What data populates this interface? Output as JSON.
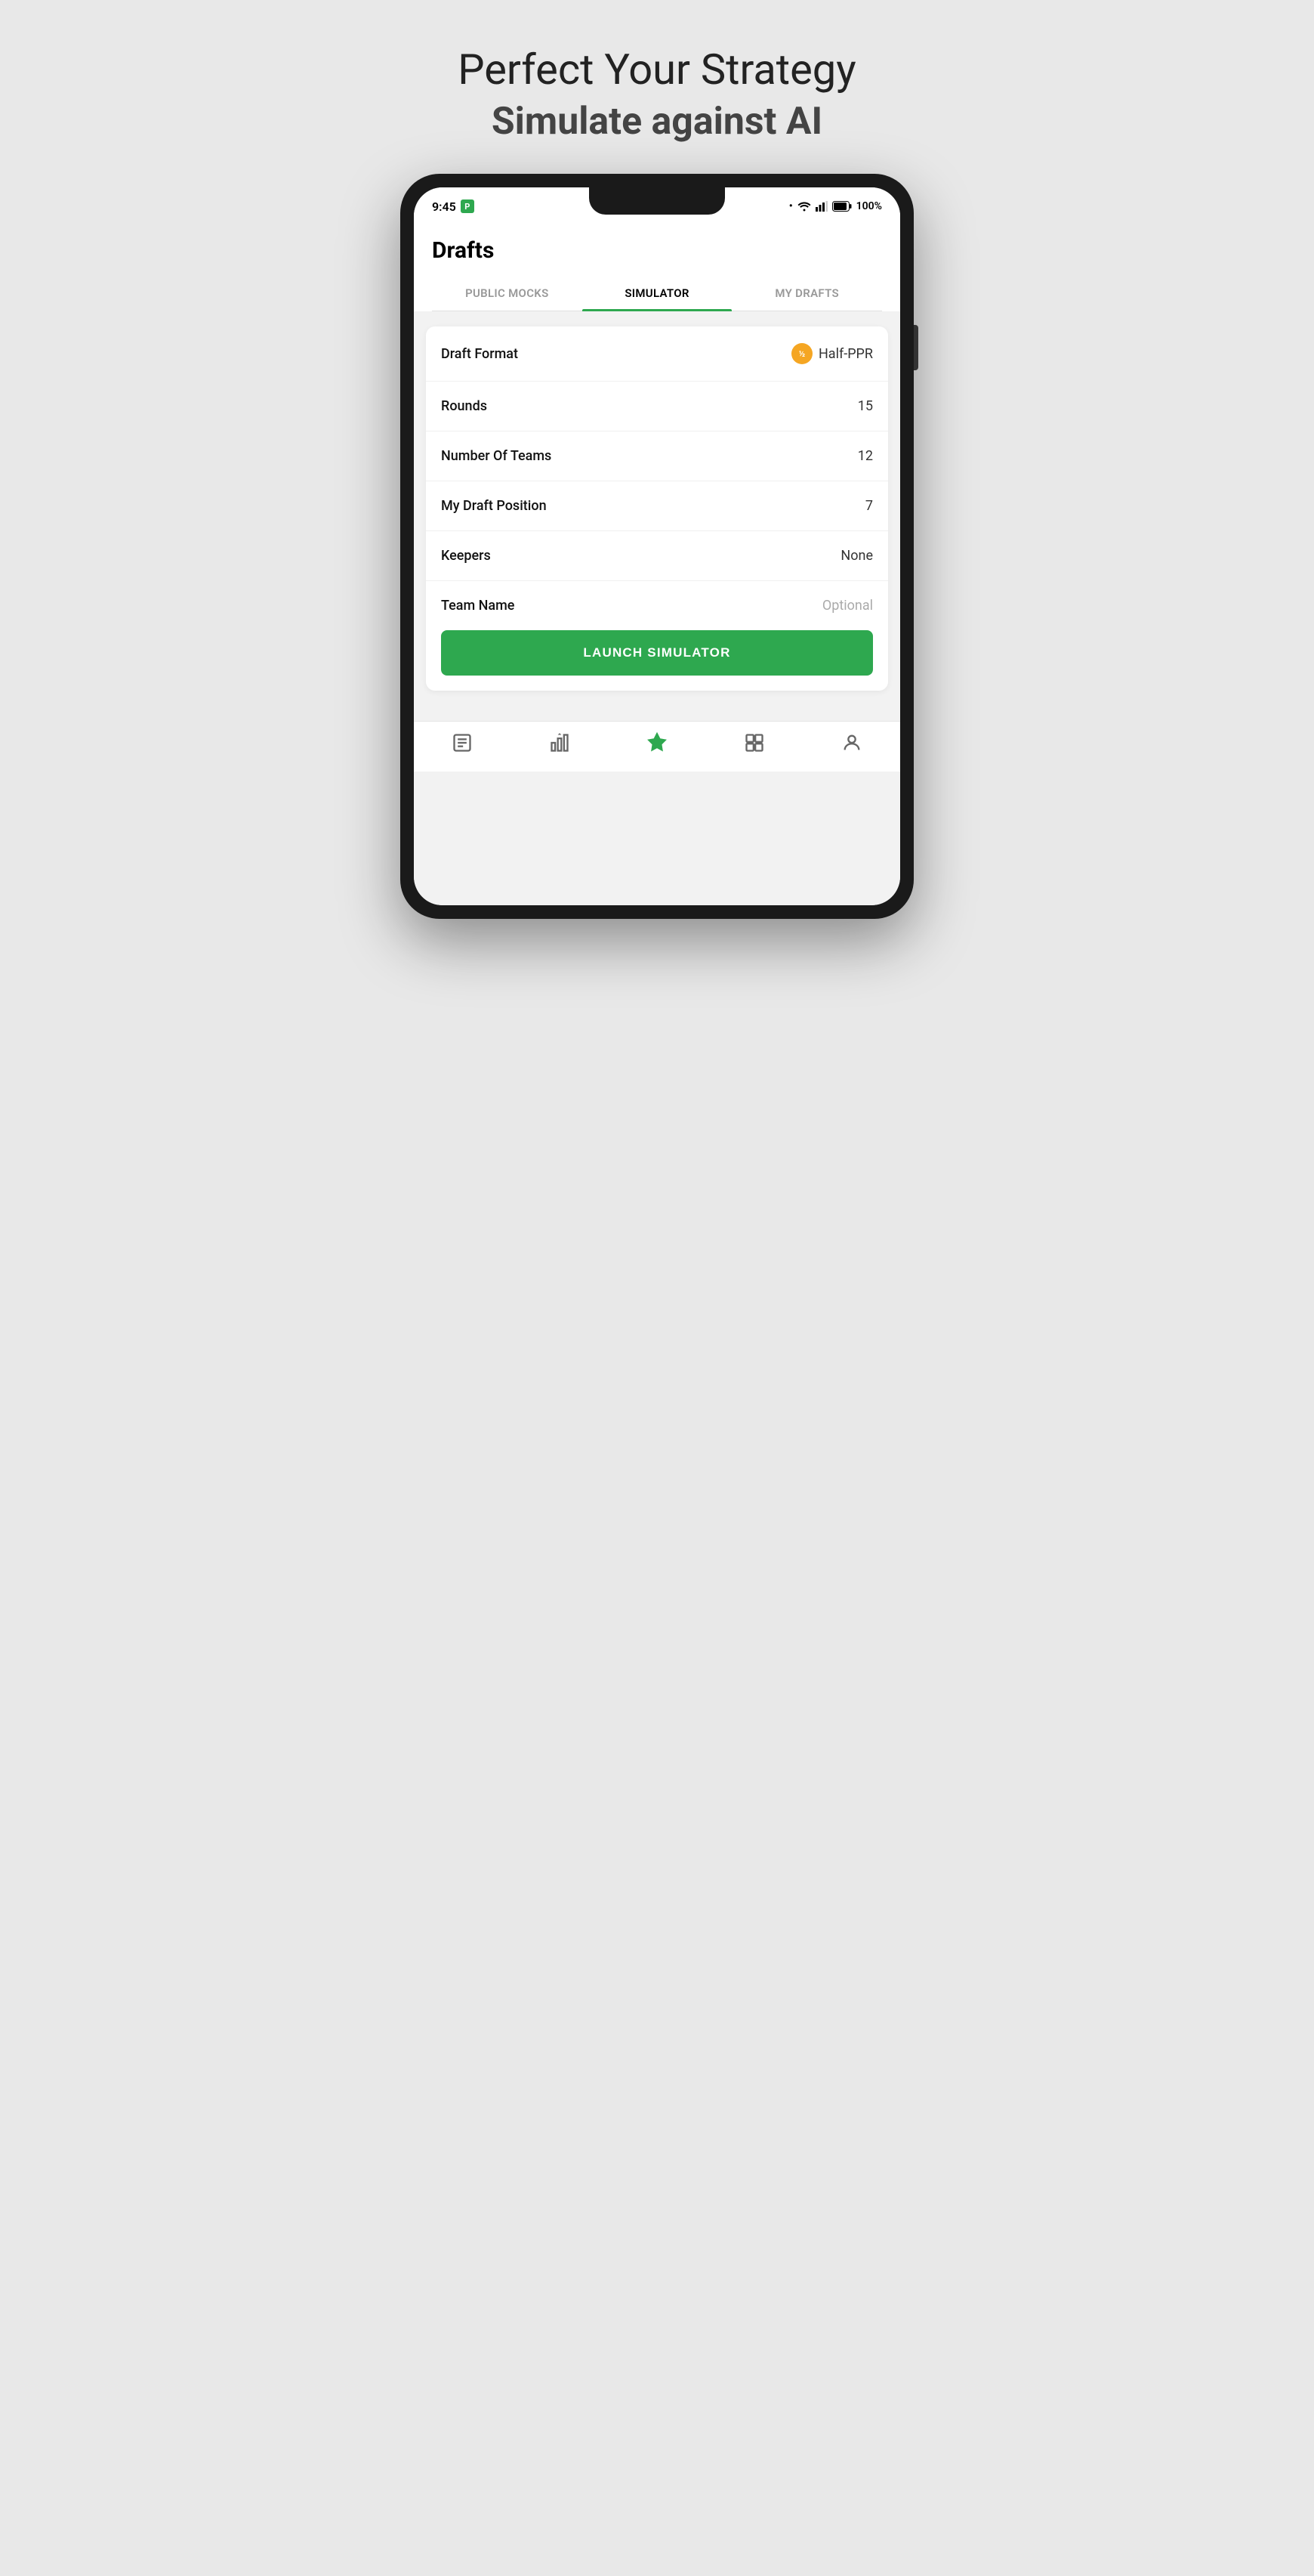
{
  "headline": "Perfect Your Strategy",
  "subheadline": "Simulate against AI",
  "status": {
    "time": "9:45",
    "battery": "100%"
  },
  "app": {
    "title": "Drafts",
    "tabs": [
      {
        "id": "public-mocks",
        "label": "PUBLIC MOCKS",
        "active": false
      },
      {
        "id": "simulator",
        "label": "SIMULATOR",
        "active": true
      },
      {
        "id": "my-drafts",
        "label": "MY DRAFTS",
        "active": false
      }
    ],
    "settings": [
      {
        "id": "draft-format",
        "label": "Draft Format",
        "value": "Half-PPR",
        "hasBadge": true,
        "badgeText": "1/2",
        "isOptional": false
      },
      {
        "id": "rounds",
        "label": "Rounds",
        "value": "15",
        "hasBadge": false,
        "isOptional": false
      },
      {
        "id": "number-of-teams",
        "label": "Number Of Teams",
        "value": "12",
        "hasBadge": false,
        "isOptional": false
      },
      {
        "id": "my-draft-position",
        "label": "My Draft Position",
        "value": "7",
        "hasBadge": false,
        "isOptional": false
      },
      {
        "id": "keepers",
        "label": "Keepers",
        "value": "None",
        "hasBadge": false,
        "isOptional": false
      },
      {
        "id": "team-name",
        "label": "Team Name",
        "value": "Optional",
        "hasBadge": false,
        "isOptional": true
      }
    ],
    "launch_button": "LAUNCH SIMULATOR"
  },
  "nav": {
    "items": [
      {
        "id": "news",
        "label": "News"
      },
      {
        "id": "rankings",
        "label": "Rankings"
      },
      {
        "id": "drafts",
        "label": "Drafts"
      },
      {
        "id": "tools",
        "label": "Tools"
      },
      {
        "id": "profile",
        "label": "Profile"
      }
    ]
  }
}
